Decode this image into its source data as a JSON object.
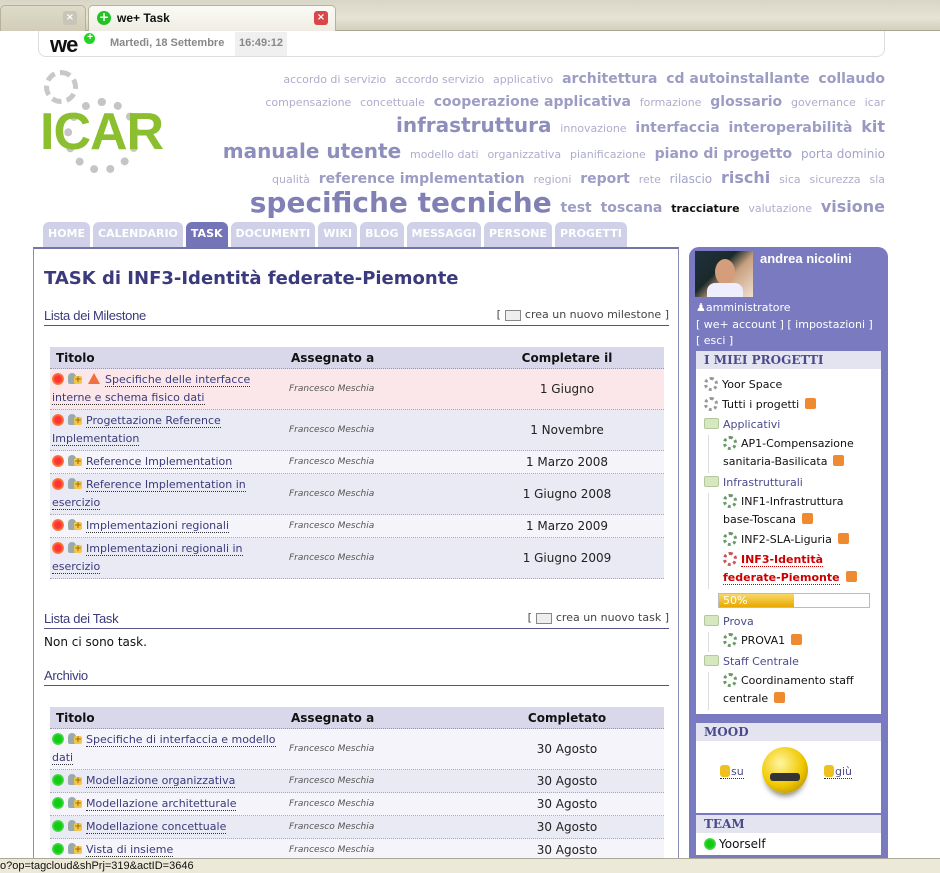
{
  "browser": {
    "tabs": [
      {
        "label": "",
        "active": false
      },
      {
        "label": "we+ Task",
        "active": true
      }
    ],
    "status_url": "o?op=tagcloud&shPrj=319&actID=3646"
  },
  "topbar": {
    "logo": "we",
    "date": "Martedì, 18 Settembre",
    "time": "16:49:12"
  },
  "brand": {
    "logo_text": "ICAR",
    "accent": "#8cbf2f"
  },
  "tagcloud": [
    {
      "t": "accordo di servizio",
      "w": 1
    },
    {
      "t": "accordo servizio",
      "w": 1
    },
    {
      "t": "applicativo",
      "w": 1
    },
    {
      "t": "architettura",
      "w": 3
    },
    {
      "t": "cd autoinstallante",
      "w": 3
    },
    {
      "t": "collaudo",
      "w": 3
    },
    {
      "t": "compensazione",
      "w": 1
    },
    {
      "t": "concettuale",
      "w": 1
    },
    {
      "t": "cooperazione applicativa",
      "w": 3
    },
    {
      "t": "formazione",
      "w": 1
    },
    {
      "t": "glossario",
      "w": 3
    },
    {
      "t": "governance",
      "w": 1
    },
    {
      "t": "icar",
      "w": 1
    },
    {
      "t": "infrastruttura",
      "w": 5
    },
    {
      "t": "innovazione",
      "w": 1
    },
    {
      "t": "interfaccia",
      "w": 3
    },
    {
      "t": "interoperabilità",
      "w": 3
    },
    {
      "t": "kit",
      "w": 4
    },
    {
      "t": "manuale utente",
      "w": 5
    },
    {
      "t": "modello dati",
      "w": 1
    },
    {
      "t": "organizzativa",
      "w": 1
    },
    {
      "t": "pianificazione",
      "w": 1
    },
    {
      "t": "piano di progetto",
      "w": 3
    },
    {
      "t": "porta dominio",
      "w": 2
    },
    {
      "t": "qualità",
      "w": 1
    },
    {
      "t": "reference implementation",
      "w": 3
    },
    {
      "t": "regioni",
      "w": 1
    },
    {
      "t": "report",
      "w": 3
    },
    {
      "t": "rete",
      "w": 1
    },
    {
      "t": "rilascio",
      "w": 2
    },
    {
      "t": "rischi",
      "w": 4
    },
    {
      "t": "sica",
      "w": 1
    },
    {
      "t": "sicurezza",
      "w": 1
    },
    {
      "t": "sla",
      "w": 1
    },
    {
      "t": "specifiche tecniche",
      "w": 6
    },
    {
      "t": "test",
      "w": 3
    },
    {
      "t": "toscana",
      "w": 3
    },
    {
      "t": "tracciature",
      "w": 0
    },
    {
      "t": "valutazione",
      "w": 1
    },
    {
      "t": "visione",
      "w": 4
    }
  ],
  "nav": {
    "tabs": [
      "HOME",
      "CALENDARIO",
      "TASK",
      "DOCUMENTI",
      "WIKI",
      "BLOG",
      "MESSAGGI",
      "PERSONE",
      "PROGETTI"
    ],
    "active": "TASK"
  },
  "main": {
    "title": "TASK di INF3-Identità federate-Piemonte",
    "milestones": {
      "label": "Lista dei Milestone",
      "action": "crea un nuovo milestone",
      "headers": [
        "Titolo",
        "Assegnato a",
        "Completare il"
      ],
      "rows": [
        {
          "title": "Specifiche delle interfacce interne e schema fisico dati",
          "assignee": "Francesco Meschia",
          "date": "1 Giugno",
          "warning": true
        },
        {
          "title": "Progettazione Reference Implementation",
          "assignee": "Francesco Meschia",
          "date": "1 Novembre",
          "warning": false
        },
        {
          "title": "Reference Implementation",
          "assignee": "Francesco Meschia",
          "date": "1 Marzo 2008",
          "warning": false
        },
        {
          "title": "Reference Implementation in esercizio",
          "assignee": "Francesco Meschia",
          "date": "1 Giugno 2008",
          "warning": false
        },
        {
          "title": "Implementazioni regionali",
          "assignee": "Francesco Meschia",
          "date": "1 Marzo 2009",
          "warning": false
        },
        {
          "title": "Implementazioni regionali in esercizio",
          "assignee": "Francesco Meschia",
          "date": "1 Giugno 2009",
          "warning": false
        }
      ]
    },
    "tasks": {
      "label": "Lista dei Task",
      "action": "crea un nuovo task",
      "empty": "Non ci sono task."
    },
    "archive": {
      "label": "Archivio",
      "headers": [
        "Titolo",
        "Assegnato a",
        "Completato"
      ],
      "rows": [
        {
          "title": "Specifiche di interfaccia e modello dati",
          "assignee": "Francesco Meschia",
          "date": "30 Agosto"
        },
        {
          "title": "Modellazione organizzativa",
          "assignee": "Francesco Meschia",
          "date": "30 Agosto"
        },
        {
          "title": "Modellazione architetturale",
          "assignee": "Francesco Meschia",
          "date": "30 Agosto"
        },
        {
          "title": "Modellazione concettuale",
          "assignee": "Francesco Meschia",
          "date": "30 Agosto"
        },
        {
          "title": "Vista di insieme",
          "assignee": "Francesco Meschia",
          "date": "30 Agosto"
        }
      ]
    }
  },
  "sidebar": {
    "user": {
      "name": "andrea nicolini",
      "role": "amministratore",
      "links": [
        "[ we+ account ]",
        "[ impostazioni ]",
        "[ esci ]"
      ]
    },
    "projects": {
      "heading": "I MIEI PROGETTI",
      "yoor_space": "Yoor Space",
      "all_projects": "Tutti i progetti",
      "groups": [
        {
          "name": "Applicativi",
          "items": [
            {
              "name": "AP1-Compensazione sanitaria-Basilicata",
              "current": false
            }
          ]
        },
        {
          "name": "Infrastrutturali",
          "items": [
            {
              "name": "INF1-Infrastruttura base-Toscana",
              "current": false
            },
            {
              "name": "INF2-SLA-Liguria",
              "current": false
            },
            {
              "name": "INF3-Identità federate-Piemonte",
              "current": true
            }
          ]
        },
        {
          "name": "Prova",
          "items": [
            {
              "name": "PROVA1",
              "current": false
            }
          ]
        },
        {
          "name": "Staff Centrale",
          "items": [
            {
              "name": "Coordinamento staff centrale",
              "current": false
            }
          ]
        }
      ],
      "progress_percent": 50,
      "progress_label": "50%"
    },
    "mood": {
      "heading": "MOOD",
      "up": "su",
      "down": "giù"
    },
    "team": {
      "heading": "TEAM",
      "members": [
        "Yoorself"
      ]
    }
  }
}
